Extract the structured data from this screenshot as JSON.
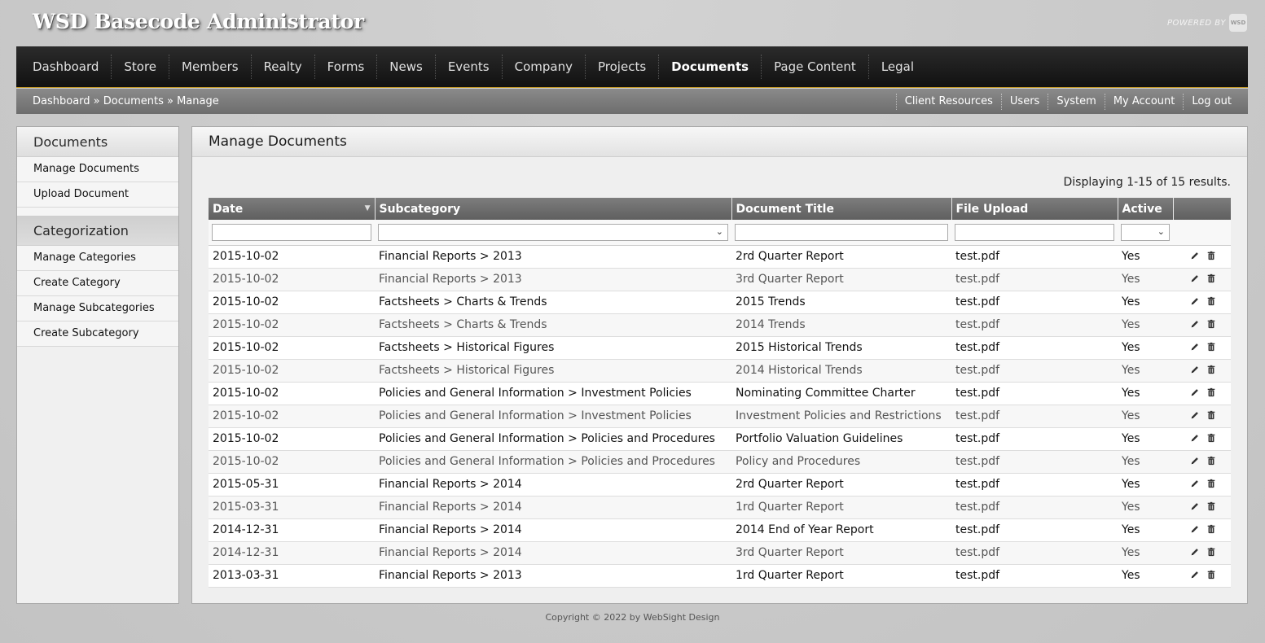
{
  "header": {
    "title": "WSD Basecode Administrator",
    "powered_by": "POWERED BY",
    "logo_text": "WSD"
  },
  "nav": {
    "items": [
      {
        "label": "Dashboard"
      },
      {
        "label": "Store"
      },
      {
        "label": "Members"
      },
      {
        "label": "Realty"
      },
      {
        "label": "Forms"
      },
      {
        "label": "News"
      },
      {
        "label": "Events"
      },
      {
        "label": "Company"
      },
      {
        "label": "Projects"
      },
      {
        "label": "Documents"
      },
      {
        "label": "Page Content"
      },
      {
        "label": "Legal"
      }
    ],
    "active": "Documents"
  },
  "breadcrumb": {
    "items": [
      "Dashboard",
      "Documents",
      "Manage"
    ],
    "separator": " » "
  },
  "sublinks": [
    "Client Resources",
    "Users",
    "System",
    "My Account",
    "Log out"
  ],
  "sidebar": {
    "sections": [
      {
        "heading": "Documents",
        "links": [
          "Manage Documents",
          "Upload Document"
        ]
      },
      {
        "heading": "Categorization",
        "links": [
          "Manage Categories",
          "Create Category",
          "Manage Subcategories",
          "Create Subcategory"
        ]
      }
    ]
  },
  "main": {
    "title": "Manage Documents",
    "summary": "Displaying 1-15 of 15 results.",
    "columns": [
      "Date",
      "Subcategory",
      "Document Title",
      "File Upload",
      "Active"
    ],
    "rows": [
      [
        "2015-10-02",
        "Financial Reports > 2013",
        "2rd Quarter Report",
        "test.pdf",
        "Yes"
      ],
      [
        "2015-10-02",
        "Financial Reports > 2013",
        "3rd Quarter Report",
        "test.pdf",
        "Yes"
      ],
      [
        "2015-10-02",
        "Factsheets > Charts & Trends",
        "2015 Trends",
        "test.pdf",
        "Yes"
      ],
      [
        "2015-10-02",
        "Factsheets > Charts & Trends",
        "2014 Trends",
        "test.pdf",
        "Yes"
      ],
      [
        "2015-10-02",
        "Factsheets > Historical Figures",
        "2015 Historical Trends",
        "test.pdf",
        "Yes"
      ],
      [
        "2015-10-02",
        "Factsheets > Historical Figures",
        "2014 Historical Trends",
        "test.pdf",
        "Yes"
      ],
      [
        "2015-10-02",
        "Policies and General Information > Investment Policies",
        "Nominating Committee Charter",
        "test.pdf",
        "Yes"
      ],
      [
        "2015-10-02",
        "Policies and General Information > Investment Policies",
        "Investment Policies and Restrictions",
        "test.pdf",
        "Yes"
      ],
      [
        "2015-10-02",
        "Policies and General Information > Policies and Procedures",
        "Portfolio Valuation Guidelines",
        "test.pdf",
        "Yes"
      ],
      [
        "2015-10-02",
        "Policies and General Information > Policies and Procedures",
        "Policy and Procedures",
        "test.pdf",
        "Yes"
      ],
      [
        "2015-05-31",
        "Financial Reports > 2014",
        "2rd Quarter Report",
        "test.pdf",
        "Yes"
      ],
      [
        "2015-03-31",
        "Financial Reports > 2014",
        "1rd Quarter Report",
        "test.pdf",
        "Yes"
      ],
      [
        "2014-12-31",
        "Financial Reports > 2014",
        "2014 End of Year Report",
        "test.pdf",
        "Yes"
      ],
      [
        "2014-12-31",
        "Financial Reports > 2014",
        "3rd Quarter Report",
        "test.pdf",
        "Yes"
      ],
      [
        "2013-03-31",
        "Financial Reports > 2013",
        "1rd Quarter Report",
        "test.pdf",
        "Yes"
      ]
    ]
  },
  "footer": {
    "copyright": "Copyright © 2022 by WebSight Design"
  }
}
